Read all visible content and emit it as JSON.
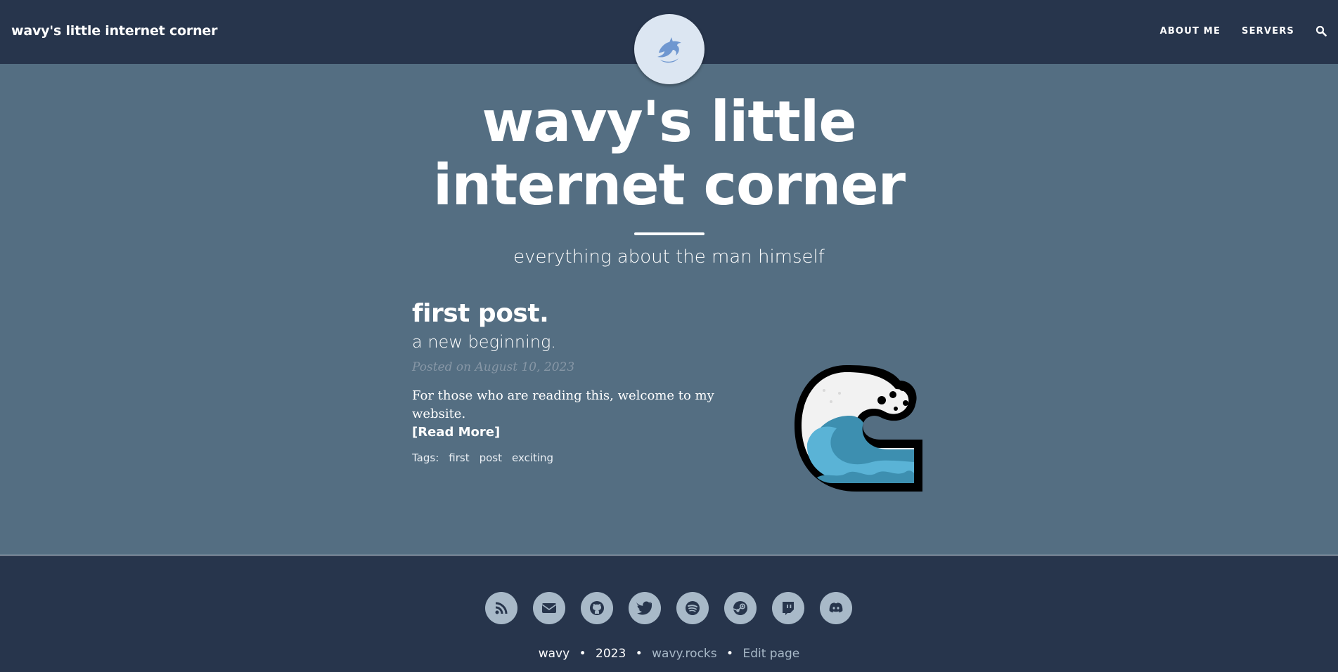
{
  "navbar": {
    "brand": "wavy's little internet corner",
    "links": [
      "ABOUT ME",
      "SERVERS"
    ],
    "search_icon": "search-icon",
    "avatar_icon": "dolphin-icon"
  },
  "hero": {
    "title": "wavy's little internet corner",
    "subtitle": "everything about the man himself"
  },
  "post": {
    "title": "first post.",
    "subtitle": "a new beginning.",
    "meta": "Posted on August 10, 2023",
    "entry": "For those who are reading this, welcome to my website.",
    "read_more": "[Read More]",
    "tags_label": "Tags:",
    "tags": [
      "first",
      "post",
      "exciting"
    ],
    "image_icon": "water-wave-icon"
  },
  "footer": {
    "social_icons": [
      "rss-icon",
      "email-icon",
      "github-icon",
      "twitter-icon",
      "spotify-icon",
      "steam-icon",
      "twitch-icon",
      "discord-icon"
    ],
    "author": "wavy",
    "year": "2023",
    "site": "wavy.rocks",
    "edit": "Edit page"
  },
  "colors": {
    "navbar_bg": "#27354c",
    "page_bg": "#546e82",
    "social_bg": "#a8b9c8"
  }
}
